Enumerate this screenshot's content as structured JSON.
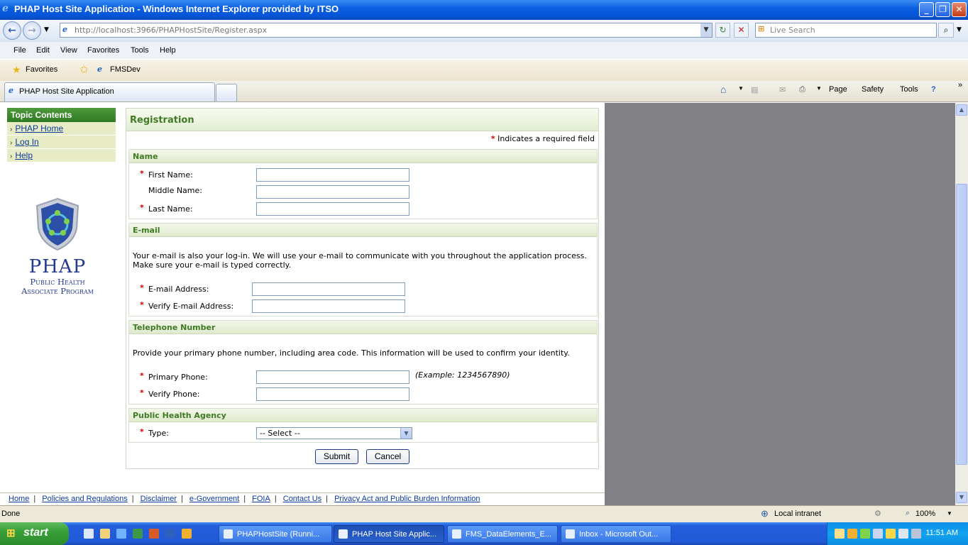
{
  "window": {
    "title": "PHAP Host Site Application - Windows Internet Explorer provided by ITSO"
  },
  "browser": {
    "url": "http://localhost:3966/PHAPHostSite/Register.aspx",
    "search_placeholder": "Live Search",
    "menu": [
      "File",
      "Edit",
      "View",
      "Favorites",
      "Tools",
      "Help"
    ],
    "favorites_label": "Favorites",
    "fav_link": "FMSDev",
    "tab_title": "PHAP Host Site Application",
    "commands": {
      "page": "Page",
      "safety": "Safety",
      "tools": "Tools"
    }
  },
  "sidebar": {
    "heading": "Topic Contents",
    "items": [
      {
        "label": "PHAP Home"
      },
      {
        "label": "Log In"
      },
      {
        "label": "Help"
      }
    ]
  },
  "logo": {
    "acronym": "PHAP",
    "line1": "Public Health",
    "line2": "Associate Program"
  },
  "form": {
    "title": "Registration",
    "required_note": "Indicates a required field",
    "required_mark": "*",
    "name_section": {
      "heading": "Name",
      "first": "First Name:",
      "middle": "Middle Name:",
      "last": "Last Name:"
    },
    "email_section": {
      "heading": "E-mail",
      "text": "Your e-mail is also your log-in. We will use your e-mail to communicate with you throughout the application process. Make sure your e-mail is typed correctly.",
      "address": "E-mail Address:",
      "verify": "Verify E-mail Address:"
    },
    "phone_section": {
      "heading": "Telephone Number",
      "text": "Provide your primary phone number, including area code. This information will be used to confirm your identity.",
      "primary": "Primary Phone:",
      "verify": "Verify Phone:",
      "example": "(Example: 1234567890)"
    },
    "agency_section": {
      "heading": "Public Health Agency",
      "type": "Type:",
      "type_value": "-- Select --"
    },
    "submit": "Submit",
    "cancel": "Cancel"
  },
  "footer": {
    "links": [
      "Home",
      "Policies and Regulations",
      "Disclaimer",
      "e-Government",
      "FOIA",
      "Contact Us",
      "Privacy Act and Public Burden Information"
    ]
  },
  "status": {
    "text": "Done",
    "zone": "Local intranet",
    "zoom": "100%"
  },
  "taskbar": {
    "start": "start",
    "items": [
      "PHAPHostSite (Runni...",
      "PHAP Host Site Applic...",
      "FMS_DataElements_E...",
      "Inbox - Microsoft Out..."
    ],
    "clock": "11:51 AM"
  },
  "colors": {
    "accent_green": "#3f7a25",
    "required_red": "#cc0000",
    "link_blue": "#0b3b9a"
  }
}
